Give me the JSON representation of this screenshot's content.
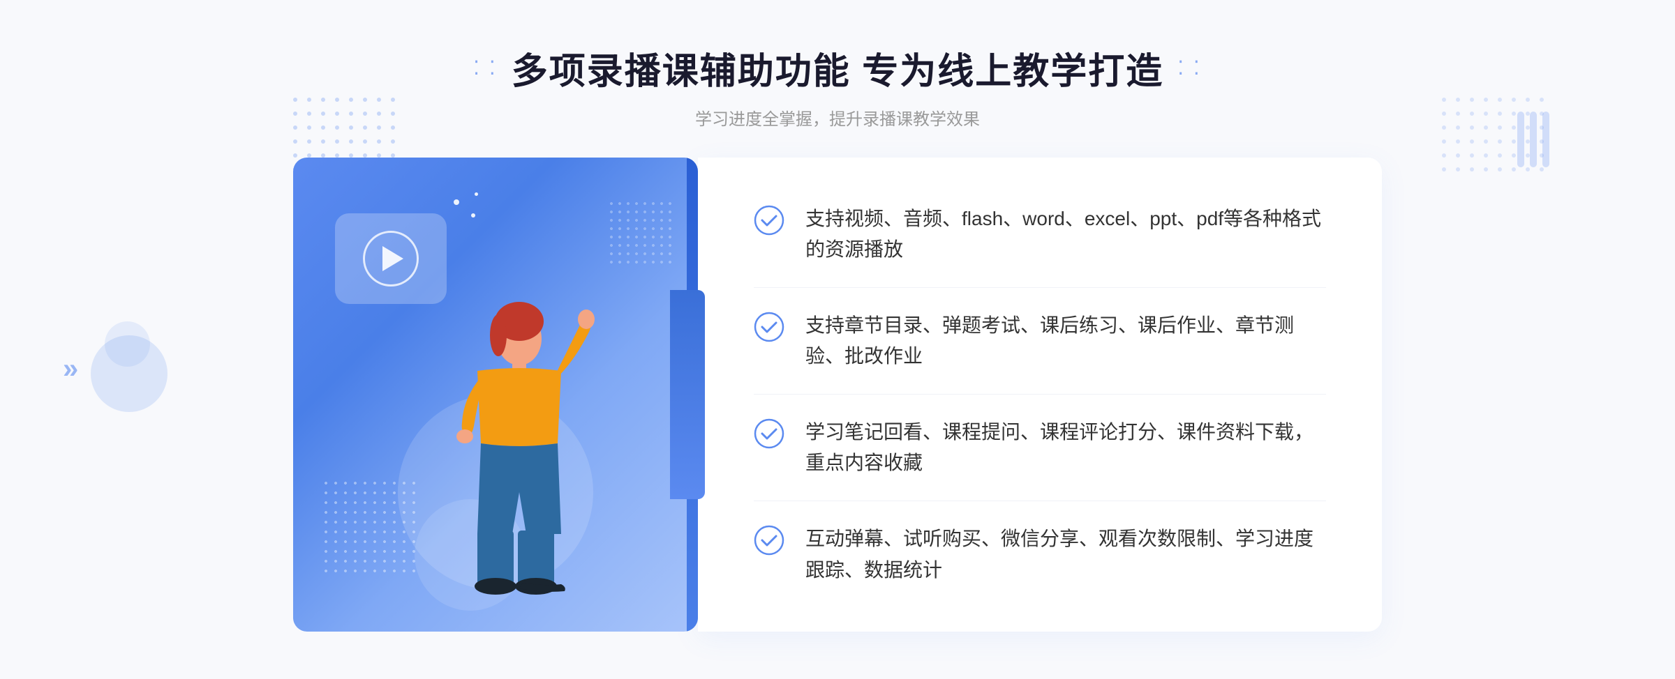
{
  "header": {
    "title": "多项录播课辅助功能 专为线上教学打造",
    "subtitle": "学习进度全掌握，提升录播课教学效果",
    "dots_left": "⁚⁚",
    "dots_right": "⁚⁚"
  },
  "features": [
    {
      "id": 1,
      "text": "支持视频、音频、flash、word、excel、ppt、pdf等各种格式的资源播放"
    },
    {
      "id": 2,
      "text": "支持章节目录、弹题考试、课后练习、课后作业、章节测验、批改作业"
    },
    {
      "id": 3,
      "text": "学习笔记回看、课程提问、课程评论打分、课件资料下载，重点内容收藏"
    },
    {
      "id": 4,
      "text": "互动弹幕、试听购买、微信分享、观看次数限制、学习进度跟踪、数据统计"
    }
  ],
  "colors": {
    "primary_blue": "#5b8af0",
    "dark_blue": "#2a5fd4",
    "text_dark": "#1a1a2e",
    "text_gray": "#999999",
    "text_body": "#333333",
    "bg_light": "#f8f9fc"
  },
  "illustration": {
    "play_icon": "▶",
    "arrows": "»"
  }
}
